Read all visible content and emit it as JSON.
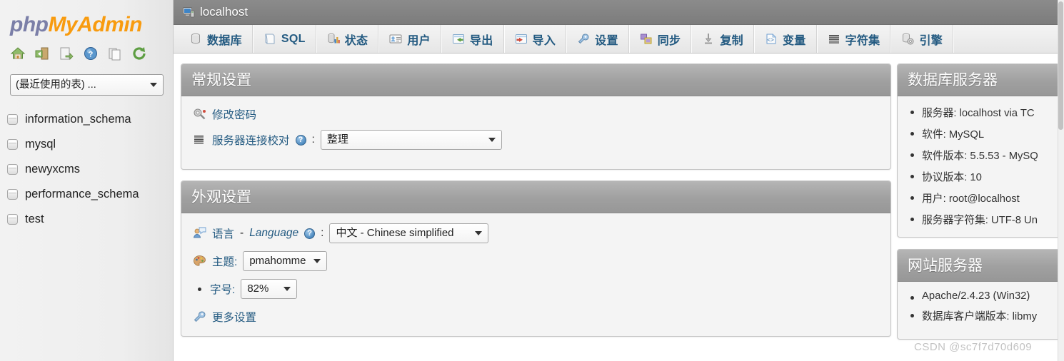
{
  "brand": {
    "php": "php",
    "my": "My",
    "admin": "Admin"
  },
  "sidebar": {
    "icons": [
      {
        "name": "home-icon",
        "label": "主页"
      },
      {
        "name": "logout-icon",
        "label": "退出"
      },
      {
        "name": "query-icon",
        "label": "查询"
      },
      {
        "name": "help-icon",
        "label": "帮助"
      },
      {
        "name": "docs-icon",
        "label": "文档"
      },
      {
        "name": "reload-icon",
        "label": "重新加载"
      }
    ],
    "recent_select": {
      "value": "(最近使用的表) ...",
      "placeholder": "(最近使用的表) ..."
    },
    "databases": [
      {
        "name": "information_schema"
      },
      {
        "name": "mysql"
      },
      {
        "name": "newyxcms"
      },
      {
        "name": "performance_schema"
      },
      {
        "name": "test"
      }
    ]
  },
  "server_bar": {
    "title": "localhost",
    "icon": "server-monitor-icon"
  },
  "tabs": [
    {
      "label": "数据库",
      "icon": "database-icon"
    },
    {
      "label": "SQL",
      "icon": "sql-icon"
    },
    {
      "label": "状态",
      "icon": "status-icon"
    },
    {
      "label": "用户",
      "icon": "users-icon"
    },
    {
      "label": "导出",
      "icon": "export-icon"
    },
    {
      "label": "导入",
      "icon": "import-icon"
    },
    {
      "label": "设置",
      "icon": "settings-wrench-icon"
    },
    {
      "label": "同步",
      "icon": "sync-icon"
    },
    {
      "label": "复制",
      "icon": "replication-icon"
    },
    {
      "label": "变量",
      "icon": "variables-icon"
    },
    {
      "label": "字符集",
      "icon": "charset-icon"
    },
    {
      "label": "引擎",
      "icon": "engines-icon"
    }
  ],
  "general_settings": {
    "title": "常规设置",
    "change_password": "修改密码",
    "collation_label": "服务器连接校对",
    "collation_help": "?",
    "collation_colon": ":",
    "collation_value": "整理"
  },
  "appearance_settings": {
    "title": "外观设置",
    "language_label": "语言",
    "language_dash": "-",
    "language_label_en": "Language",
    "language_help": "?",
    "language_colon": ":",
    "language_value": "中文 - Chinese simplified",
    "theme_label": "主题:",
    "theme_value": "pmahomme",
    "fontsize_label": "字号:",
    "fontsize_value": "82%",
    "more_settings": "更多设置"
  },
  "database_server": {
    "title": "数据库服务器",
    "items": [
      "服务器: localhost via TC",
      "软件: MySQL",
      "软件版本: 5.5.53 - MySQ",
      "协议版本: 10",
      "用户: root@localhost",
      "服务器字符集: UTF-8 Un"
    ]
  },
  "web_server": {
    "title": "网站服务器",
    "items": [
      "Apache/2.4.23 (Win32)",
      "数据库客户端版本: libmy"
    ]
  },
  "watermark": "CSDN @sc7f7d70d609",
  "colors": {
    "brand_orange": "#f89b0f",
    "brand_purple": "#7b7fa8",
    "link_blue": "#235a81",
    "panel_header_gray": "#a0a0a0",
    "server_bar_gray": "#7c7c7c"
  }
}
